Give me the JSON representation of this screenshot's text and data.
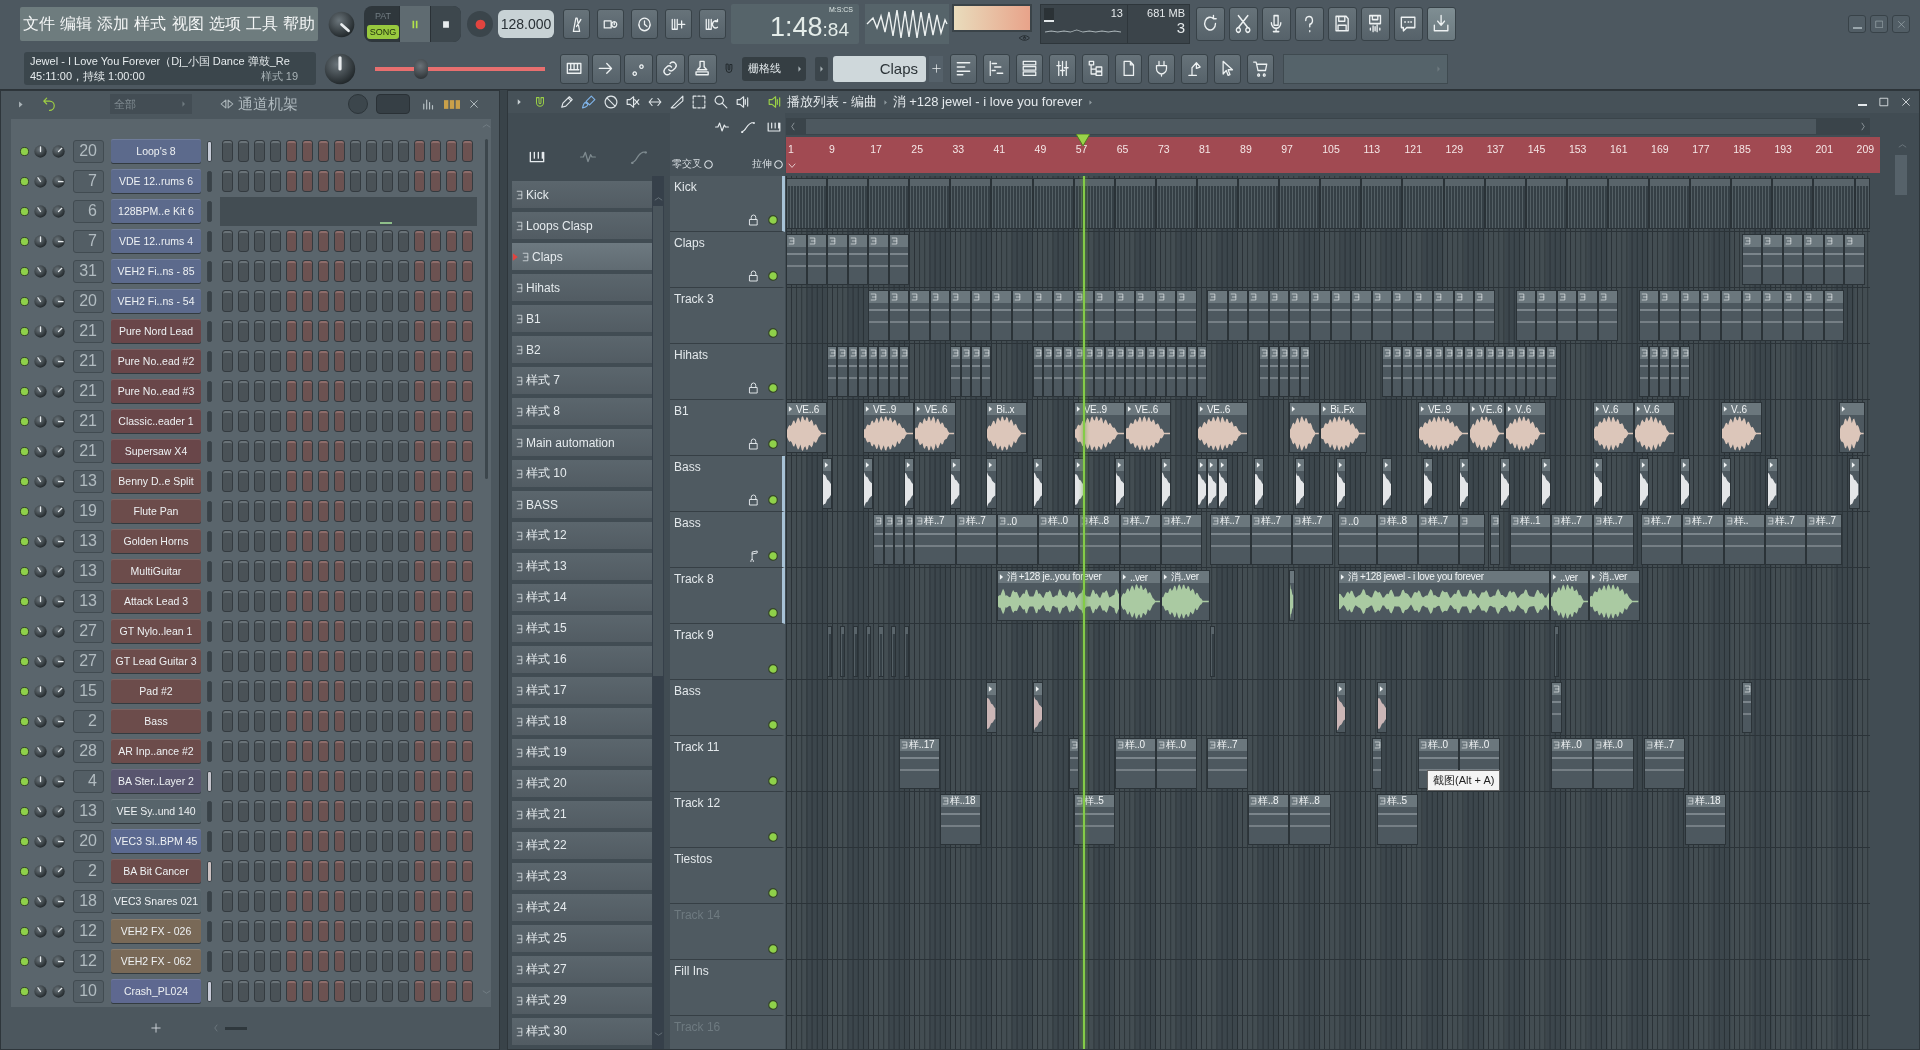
{
  "toolbar": {
    "menu": [
      "文件",
      "编辑",
      "添加",
      "样式",
      "视图",
      "选项",
      "工具",
      "帮助"
    ],
    "transport_mode": [
      {
        "label": "PAT",
        "selected": false
      },
      {
        "label": "SONG",
        "selected": true
      }
    ],
    "playing": true,
    "tempo": "128.000",
    "time": {
      "main": "1:48",
      "fraction": ":84",
      "format": "M:S:CS"
    },
    "peak_meter": {
      "level": 1
    },
    "cpu": {
      "reading": "13",
      "level": 0.12
    },
    "memory": "681 MB",
    "polyphony": "3",
    "song_info": {
      "title": "Jewel - I Love You Forever（Dj_小国 Dance 弹鼓_Re",
      "position": "45:11:00，持续 1:00:00",
      "pattern": "样式 19"
    },
    "master_pitch": {
      "level": 0.27
    },
    "snap": "栅格线",
    "pattern_selector": "Claps"
  },
  "channel_rack": {
    "filter": "全部",
    "title": "通道机架",
    "channels": [
      {
        "enabled": true,
        "mixer": "20",
        "name": "Loop's 8",
        "color": "#5c6a8c",
        "selected": true,
        "kind": "steps"
      },
      {
        "enabled": true,
        "mixer": "7",
        "name": "VDE 12..rums 6",
        "color": "#5c6a8c",
        "selected": false,
        "kind": "steps"
      },
      {
        "enabled": true,
        "mixer": "6",
        "name": "128BPM..e Kit 6",
        "color": "#5c6a8c",
        "selected": false,
        "kind": "audio"
      },
      {
        "enabled": true,
        "mixer": "7",
        "name": "VDE 12..rums 4",
        "color": "#5c6a8c",
        "selected": false,
        "kind": "steps"
      },
      {
        "enabled": true,
        "mixer": "31",
        "name": "VEH2 Fi..ns - 85",
        "color": "#5c6a8c",
        "selected": false,
        "kind": "steps"
      },
      {
        "enabled": true,
        "mixer": "20",
        "name": "VEH2 Fi..ns - 54",
        "color": "#5c6a8c",
        "selected": false,
        "kind": "steps"
      },
      {
        "enabled": true,
        "mixer": "21",
        "name": "Pure Nord Lead",
        "color": "#694649",
        "selected": false,
        "kind": "steps"
      },
      {
        "enabled": true,
        "mixer": "21",
        "name": "Pure No..ead #2",
        "color": "#694649",
        "selected": false,
        "kind": "steps"
      },
      {
        "enabled": true,
        "mixer": "21",
        "name": "Pure No..ead #3",
        "color": "#694649",
        "selected": false,
        "kind": "steps"
      },
      {
        "enabled": true,
        "mixer": "21",
        "name": "Classic..eader 1",
        "color": "#694649",
        "selected": false,
        "kind": "steps"
      },
      {
        "enabled": true,
        "mixer": "21",
        "name": "Supersaw X4",
        "color": "#694649",
        "selected": false,
        "kind": "steps"
      },
      {
        "enabled": true,
        "mixer": "13",
        "name": "Benny D..e Split",
        "color": "#6c4c4b",
        "selected": false,
        "kind": "steps"
      },
      {
        "enabled": true,
        "mixer": "19",
        "name": "Flute Pan",
        "color": "#6c4c4b",
        "selected": false,
        "kind": "steps"
      },
      {
        "enabled": true,
        "mixer": "13",
        "name": "Golden Horns",
        "color": "#6c4c4b",
        "selected": false,
        "kind": "steps"
      },
      {
        "enabled": true,
        "mixer": "13",
        "name": "MultiGuitar",
        "color": "#6c4c4b",
        "selected": false,
        "kind": "steps"
      },
      {
        "enabled": true,
        "mixer": "13",
        "name": "Attack Lead 3",
        "color": "#6c4c4b",
        "selected": false,
        "kind": "steps"
      },
      {
        "enabled": true,
        "mixer": "27",
        "name": "GT Nylo..lean 1",
        "color": "#6c4c4b",
        "selected": false,
        "kind": "steps"
      },
      {
        "enabled": true,
        "mixer": "27",
        "name": "GT Lead Guitar 3",
        "color": "#6c4c4b",
        "selected": false,
        "kind": "steps"
      },
      {
        "enabled": true,
        "mixer": "15",
        "name": "Pad #2",
        "color": "#6c4c4b",
        "selected": false,
        "kind": "steps"
      },
      {
        "enabled": true,
        "mixer": "2",
        "name": "Bass",
        "color": "#6c4c4b",
        "selected": false,
        "kind": "steps"
      },
      {
        "enabled": true,
        "mixer": "28",
        "name": "AR Inp..ance #2",
        "color": "#6c4c4b",
        "selected": false,
        "kind": "steps"
      },
      {
        "enabled": true,
        "mixer": "4",
        "name": "BA Ster..Layer 2",
        "color": "#58556e",
        "selected": true,
        "kind": "steps"
      },
      {
        "enabled": true,
        "mixer": "13",
        "name": "VEE Sy..und 140",
        "color": "#57646b",
        "selected": false,
        "kind": "steps"
      },
      {
        "enabled": true,
        "mixer": "20",
        "name": "VEC3 Sl..BPM 45",
        "color": "#5b6990",
        "selected": false,
        "kind": "steps"
      },
      {
        "enabled": true,
        "mixer": "2",
        "name": "BA Bit Cancer",
        "color": "#6c4c4b",
        "selected": true,
        "kind": "steps"
      },
      {
        "enabled": true,
        "mixer": "18",
        "name": "VEC3 Snares 021",
        "color": "#57646b",
        "selected": false,
        "kind": "steps"
      },
      {
        "enabled": true,
        "mixer": "12",
        "name": "VEH2 FX - 026",
        "color": "#796957",
        "selected": false,
        "kind": "steps"
      },
      {
        "enabled": true,
        "mixer": "12",
        "name": "VEH2 FX - 062",
        "color": "#796957",
        "selected": false,
        "kind": "steps"
      },
      {
        "enabled": true,
        "mixer": "10",
        "name": "Crash_PL024",
        "color": "#5e6890",
        "selected": true,
        "kind": "steps"
      }
    ]
  },
  "playlist": {
    "title": "播放列表 - 编曲",
    "breadcrumb": "消 +128 jewel - i love you forever",
    "patterns": [
      {
        "name": "Kick",
        "selected": false
      },
      {
        "name": "Loops Clasp",
        "selected": false
      },
      {
        "name": "Claps",
        "selected": true
      },
      {
        "name": "Hihats",
        "selected": false
      },
      {
        "name": "B1",
        "selected": false
      },
      {
        "name": "B2",
        "selected": false
      },
      {
        "name": "样式 7",
        "selected": false
      },
      {
        "name": "样式 8",
        "selected": false
      },
      {
        "name": "Main automation",
        "selected": false
      },
      {
        "name": "样式 10",
        "selected": false
      },
      {
        "name": "BASS",
        "selected": false
      },
      {
        "name": "样式 12",
        "selected": false
      },
      {
        "name": "样式 13",
        "selected": false
      },
      {
        "name": "样式 14",
        "selected": false
      },
      {
        "name": "样式 15",
        "selected": false
      },
      {
        "name": "样式 16",
        "selected": false
      },
      {
        "name": "样式 17",
        "selected": false
      },
      {
        "name": "样式 18",
        "selected": false
      },
      {
        "name": "样式 19",
        "selected": false
      },
      {
        "name": "样式 20",
        "selected": false
      },
      {
        "name": "样式 21",
        "selected": false
      },
      {
        "name": "样式 22",
        "selected": false
      },
      {
        "name": "样式 23",
        "selected": false
      },
      {
        "name": "样式 24",
        "selected": false
      },
      {
        "name": "样式 25",
        "selected": false
      },
      {
        "name": "样式 27",
        "selected": false
      },
      {
        "name": "样式 29",
        "selected": false
      },
      {
        "name": "样式 30",
        "selected": false
      }
    ],
    "toggles": [
      {
        "label": "零交叉",
        "on": false
      },
      {
        "label": "拉伸",
        "on": false
      }
    ],
    "ruler": [
      "1",
      "9",
      "17",
      "25",
      "33",
      "41",
      "49",
      "57",
      "65",
      "73",
      "81",
      "89",
      "97",
      "105",
      "113",
      "121",
      "129",
      "137",
      "145",
      "153",
      "161",
      "169",
      "177",
      "185",
      "193",
      "201",
      "209"
    ],
    "playhead": {
      "level": 0.274
    },
    "tooltip": "截图(Alt + A)",
    "tracks": [
      {
        "name": "Kick",
        "dimmed": false,
        "enabled": true,
        "selected": true,
        "locked": true,
        "note_mark": false,
        "clips": [
          {
            "kind": "compact"
          },
          {
            "kind": "compact"
          },
          {
            "kind": "compact"
          },
          {
            "kind": "compact"
          },
          {
            "kind": "compact"
          },
          {
            "kind": "compact"
          },
          {
            "kind": "compact"
          },
          {
            "kind": "compact"
          },
          {
            "kind": "compact"
          },
          {
            "kind": "compact"
          },
          {
            "kind": "compact"
          },
          {
            "kind": "compact"
          },
          {
            "kind": "compact"
          },
          {
            "kind": "compact"
          },
          {
            "kind": "compact"
          },
          {
            "kind": "compact"
          },
          {
            "kind": "compact"
          },
          {
            "kind": "compact"
          },
          {
            "kind": "compact"
          },
          {
            "kind": "compact"
          },
          {
            "kind": "compact"
          },
          {
            "kind": "compact"
          },
          {
            "kind": "compact"
          },
          {
            "kind": "compact"
          },
          {
            "kind": "compact"
          },
          {
            "kind": "compact"
          },
          {
            "kind": "compact"
          }
        ]
      },
      {
        "name": "Claps",
        "dimmed": false,
        "enabled": true,
        "selected": false,
        "locked": true,
        "note_mark": false,
        "clips": [
          {
            "kind": "pattern"
          },
          {
            "kind": "pattern"
          },
          {
            "kind": "pattern"
          },
          {
            "kind": "pattern"
          },
          {
            "kind": "pattern"
          },
          {
            "kind": "pattern"
          },
          {
            "kind": "pattern"
          },
          {
            "kind": "pattern"
          },
          {
            "kind": "pattern"
          },
          {
            "kind": "pattern"
          },
          {
            "kind": "pattern"
          },
          {
            "kind": "pattern"
          }
        ]
      },
      {
        "name": "Track 3",
        "dimmed": false,
        "enabled": true,
        "selected": false,
        "locked": false,
        "note_mark": false,
        "clips": [
          {
            "kind": "pattern"
          },
          {
            "kind": "pattern"
          },
          {
            "kind": "pattern"
          },
          {
            "kind": "pattern"
          },
          {
            "kind": "pattern"
          },
          {
            "kind": "pattern"
          },
          {
            "kind": "pattern"
          },
          {
            "kind": "pattern"
          },
          {
            "kind": "pattern"
          },
          {
            "kind": "pattern"
          },
          {
            "kind": "pattern"
          },
          {
            "kind": "pattern"
          },
          {
            "kind": "pattern"
          },
          {
            "kind": "pattern"
          },
          {
            "kind": "pattern"
          },
          {
            "kind": "pattern"
          },
          {
            "kind": "pattern"
          },
          {
            "kind": "pattern"
          },
          {
            "kind": "pattern"
          },
          {
            "kind": "pattern"
          },
          {
            "kind": "pattern"
          },
          {
            "kind": "pattern"
          },
          {
            "kind": "pattern"
          },
          {
            "kind": "pattern"
          },
          {
            "kind": "pattern"
          },
          {
            "kind": "pattern"
          },
          {
            "kind": "pattern"
          },
          {
            "kind": "pattern"
          },
          {
            "kind": "pattern"
          },
          {
            "kind": "pattern"
          },
          {
            "kind": "pattern"
          },
          {
            "kind": "pattern"
          },
          {
            "kind": "pattern"
          },
          {
            "kind": "pattern"
          },
          {
            "kind": "pattern"
          },
          {
            "kind": "pattern"
          },
          {
            "kind": "pattern"
          },
          {
            "kind": "pattern"
          },
          {
            "kind": "pattern"
          },
          {
            "kind": "pattern"
          },
          {
            "kind": "pattern"
          },
          {
            "kind": "pattern"
          },
          {
            "kind": "pattern"
          },
          {
            "kind": "pattern"
          },
          {
            "kind": "pattern"
          }
        ]
      },
      {
        "name": "Hihats",
        "dimmed": false,
        "enabled": true,
        "selected": false,
        "locked": true,
        "note_mark": false,
        "clips": [
          {
            "kind": "pattern"
          },
          {
            "kind": "pattern"
          },
          {
            "kind": "pattern"
          },
          {
            "kind": "pattern"
          },
          {
            "kind": "pattern"
          },
          {
            "kind": "pattern"
          },
          {
            "kind": "pattern"
          },
          {
            "kind": "pattern"
          },
          {
            "kind": "pattern"
          },
          {
            "kind": "pattern"
          },
          {
            "kind": "pattern"
          },
          {
            "kind": "pattern"
          },
          {
            "kind": "pattern"
          },
          {
            "kind": "pattern"
          },
          {
            "kind": "pattern"
          },
          {
            "kind": "pattern"
          },
          {
            "kind": "pattern"
          },
          {
            "kind": "pattern"
          },
          {
            "kind": "pattern"
          },
          {
            "kind": "pattern"
          },
          {
            "kind": "pattern"
          },
          {
            "kind": "pattern"
          },
          {
            "kind": "pattern"
          },
          {
            "kind": "pattern"
          },
          {
            "kind": "pattern"
          },
          {
            "kind": "pattern"
          },
          {
            "kind": "pattern"
          },
          {
            "kind": "pattern"
          },
          {
            "kind": "pattern"
          },
          {
            "kind": "pattern"
          },
          {
            "kind": "pattern"
          },
          {
            "kind": "pattern"
          },
          {
            "kind": "pattern"
          },
          {
            "kind": "pattern"
          },
          {
            "kind": "pattern"
          },
          {
            "kind": "pattern"
          },
          {
            "kind": "pattern"
          },
          {
            "kind": "pattern"
          },
          {
            "kind": "pattern"
          },
          {
            "kind": "pattern"
          },
          {
            "kind": "pattern"
          },
          {
            "kind": "pattern"
          },
          {
            "kind": "pattern"
          },
          {
            "kind": "pattern"
          },
          {
            "kind": "pattern"
          },
          {
            "kind": "pattern"
          },
          {
            "kind": "pattern"
          },
          {
            "kind": "pattern"
          },
          {
            "kind": "pattern"
          },
          {
            "kind": "pattern"
          },
          {
            "kind": "pattern"
          },
          {
            "kind": "pattern"
          },
          {
            "kind": "pattern"
          },
          {
            "kind": "pattern"
          },
          {
            "kind": "pattern"
          },
          {
            "kind": "pattern"
          }
        ]
      },
      {
        "name": "B1",
        "dimmed": false,
        "enabled": true,
        "selected": false,
        "locked": true,
        "note_mark": false,
        "color": "#dcc6ba",
        "clips": [
          {
            "kind": "audio",
            "label": "VE..6"
          },
          {
            "kind": "audio",
            "label": "VE..9"
          },
          {
            "kind": "audio",
            "label": "VE..6"
          },
          {
            "kind": "audio",
            "label": "Bi..x"
          },
          {
            "kind": "audio",
            "label": "VE..9"
          },
          {
            "kind": "audio",
            "label": "VE..6"
          },
          {
            "kind": "audio",
            "label": "VE..6"
          },
          {
            "kind": "audio"
          },
          {
            "kind": "audio",
            "label": "Bi..Fx"
          },
          {
            "kind": "audio",
            "label": "VE..9"
          },
          {
            "kind": "audio",
            "label": "VE..6"
          },
          {
            "kind": "audio",
            "label": "V..6"
          },
          {
            "kind": "audio",
            "label": "V..6"
          },
          {
            "kind": "audio",
            "label": "V..6"
          },
          {
            "kind": "audio",
            "label": "V..6"
          },
          {
            "kind": "audio"
          }
        ]
      },
      {
        "name": "Bass",
        "dimmed": false,
        "enabled": true,
        "selected": true,
        "locked": true,
        "note_mark": false,
        "color": "#e4e6e8",
        "clips": [
          {
            "kind": "audio"
          },
          {
            "kind": "audio"
          },
          {
            "kind": "audio"
          },
          {
            "kind": "audio"
          },
          {
            "kind": "audio"
          },
          {
            "kind": "audio"
          },
          {
            "kind": "audio"
          },
          {
            "kind": "audio"
          },
          {
            "kind": "audio"
          },
          {
            "kind": "audio"
          },
          {
            "kind": "audio"
          },
          {
            "kind": "audio"
          },
          {
            "kind": "audio"
          },
          {
            "kind": "audio"
          },
          {
            "kind": "audio"
          },
          {
            "kind": "audio"
          },
          {
            "kind": "audio"
          },
          {
            "kind": "audio"
          },
          {
            "kind": "audio"
          },
          {
            "kind": "audio"
          },
          {
            "kind": "audio"
          },
          {
            "kind": "audio"
          },
          {
            "kind": "audio"
          },
          {
            "kind": "audio"
          },
          {
            "kind": "audio"
          },
          {
            "kind": "audio"
          }
        ]
      },
      {
        "name": "Bass",
        "dimmed": false,
        "enabled": true,
        "selected": true,
        "locked": false,
        "note_mark": true,
        "clips": [
          {
            "kind": "pattern"
          },
          {
            "kind": "pattern"
          },
          {
            "kind": "pattern"
          },
          {
            "kind": "pattern"
          },
          {
            "kind": "pattern",
            "label": "样..7"
          },
          {
            "kind": "pattern",
            "label": "样..7"
          },
          {
            "kind": "pattern",
            "label": "..0"
          },
          {
            "kind": "pattern",
            "label": "样..0"
          },
          {
            "kind": "pattern",
            "label": "样..8"
          },
          {
            "kind": "pattern",
            "label": "样..7"
          },
          {
            "kind": "pattern",
            "label": "样..7"
          },
          {
            "kind": "pattern",
            "label": "样..7"
          },
          {
            "kind": "pattern",
            "label": "样..7"
          },
          {
            "kind": "pattern",
            "label": "样..7"
          },
          {
            "kind": "pattern",
            "label": "..0"
          },
          {
            "kind": "pattern",
            "label": "样..8"
          },
          {
            "kind": "pattern",
            "label": "样..7"
          },
          {
            "kind": "pattern"
          },
          {
            "kind": "pattern"
          },
          {
            "kind": "pattern",
            "label": "样..1"
          },
          {
            "kind": "pattern",
            "label": "样..7"
          },
          {
            "kind": "pattern",
            "label": "样..7"
          },
          {
            "kind": "pattern",
            "label": "样..7"
          },
          {
            "kind": "pattern",
            "label": "样..7"
          },
          {
            "kind": "pattern",
            "label": "样.."
          },
          {
            "kind": "pattern",
            "label": "样..7"
          },
          {
            "kind": "pattern",
            "label": "样..7"
          }
        ]
      },
      {
        "name": "Track 8",
        "dimmed": false,
        "enabled": true,
        "selected": true,
        "locked": false,
        "note_mark": false,
        "color": "#aacaa2",
        "clips": [
          {
            "kind": "audio",
            "label": "消 +128 je..you forever"
          },
          {
            "kind": "audio",
            "label": "..ver"
          },
          {
            "kind": "audio",
            "label": "消..ver"
          },
          {
            "kind": "audio"
          },
          {
            "kind": "audio",
            "label": "消 +128 jewel - i love you forever"
          },
          {
            "kind": "audio",
            "label": "..ver"
          },
          {
            "kind": "audio",
            "label": "消..ver"
          }
        ]
      },
      {
        "name": "Track 9",
        "dimmed": false,
        "enabled": true,
        "selected": false,
        "locked": false,
        "note_mark": false,
        "clips": [
          {
            "kind": "compact"
          },
          {
            "kind": "compact"
          },
          {
            "kind": "compact"
          },
          {
            "kind": "compact"
          },
          {
            "kind": "compact"
          },
          {
            "kind": "compact"
          },
          {
            "kind": "compact"
          },
          {
            "kind": "compact"
          },
          {
            "kind": "compact"
          }
        ]
      },
      {
        "name": "Bass",
        "dimmed": false,
        "enabled": true,
        "selected": false,
        "locked": false,
        "note_mark": false,
        "color": "#cbb6b6",
        "clips": [
          {
            "kind": "audio"
          },
          {
            "kind": "audio"
          },
          {
            "kind": "audio"
          },
          {
            "kind": "audio"
          },
          {
            "kind": "pattern"
          },
          {
            "kind": "pattern"
          }
        ]
      },
      {
        "name": "Track 11",
        "dimmed": false,
        "enabled": true,
        "selected": false,
        "locked": false,
        "note_mark": false,
        "clips": [
          {
            "kind": "pattern",
            "label": "样..17"
          },
          {
            "kind": "pattern"
          },
          {
            "kind": "pattern",
            "label": "样..0"
          },
          {
            "kind": "pattern",
            "label": "样..0"
          },
          {
            "kind": "pattern",
            "label": "样..7"
          },
          {
            "kind": "pattern"
          },
          {
            "kind": "pattern",
            "label": "样..0"
          },
          {
            "kind": "pattern",
            "label": "样..0"
          },
          {
            "kind": "pattern",
            "label": "样..0"
          },
          {
            "kind": "pattern",
            "label": "样..0"
          },
          {
            "kind": "pattern",
            "label": "样..7"
          }
        ]
      },
      {
        "name": "Track 12",
        "dimmed": false,
        "enabled": true,
        "selected": false,
        "locked": false,
        "note_mark": false,
        "clips": [
          {
            "kind": "pattern",
            "label": "样..18"
          },
          {
            "kind": "pattern",
            "label": "样..5"
          },
          {
            "kind": "pattern",
            "label": "样..8"
          },
          {
            "kind": "pattern",
            "label": "样..8"
          },
          {
            "kind": "pattern",
            "label": "样..5"
          },
          {
            "kind": "pattern",
            "label": "样..18"
          }
        ]
      },
      {
        "name": "Tiestos",
        "dimmed": false,
        "enabled": true,
        "selected": false,
        "locked": false,
        "note_mark": false
      },
      {
        "name": "Track 14",
        "dimmed": true,
        "enabled": true,
        "selected": false,
        "locked": false,
        "note_mark": false
      },
      {
        "name": "Fill Ins",
        "dimmed": false,
        "enabled": true,
        "selected": false,
        "locked": false,
        "note_mark": false
      },
      {
        "name": "Track 16",
        "dimmed": true,
        "selected": false,
        "locked": false,
        "note_mark": false
      }
    ]
  }
}
